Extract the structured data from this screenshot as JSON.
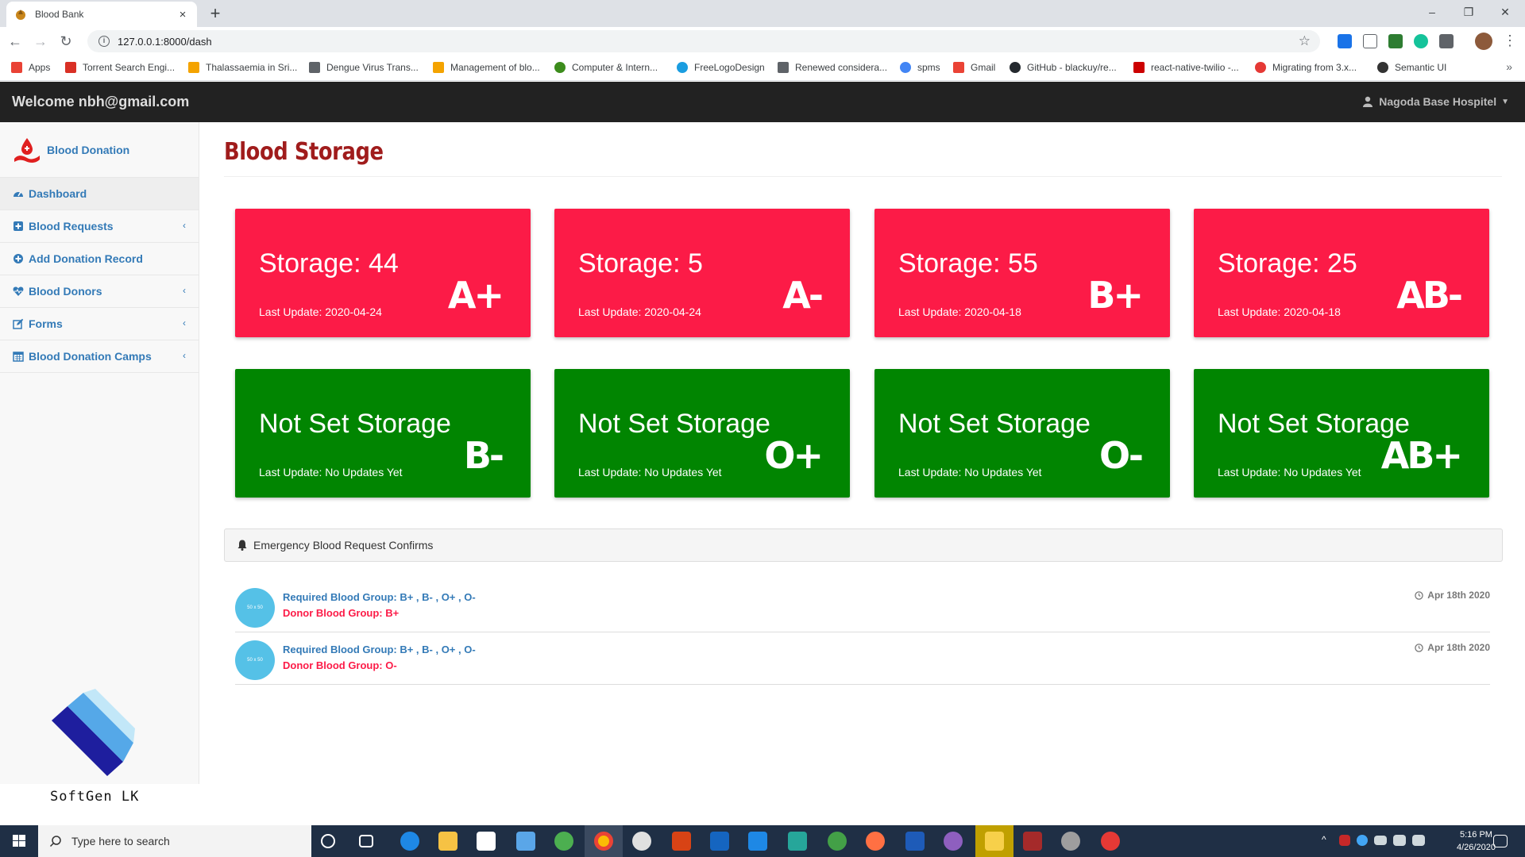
{
  "browser": {
    "tab_title": "Blood Bank",
    "tab_close": "×",
    "new_tab": "+",
    "url": "127.0.0.1:8000/dash",
    "window_minimize": "–",
    "window_restore": "❐",
    "window_close": "✕",
    "bookmarks": [
      {
        "label": "Apps",
        "color": "#e94235"
      },
      {
        "label": "Torrent Search Engi...",
        "color": "#d93025"
      },
      {
        "label": "Thalassaemia in Sri...",
        "color": "#f4a300"
      },
      {
        "label": "Dengue Virus Trans...",
        "color": "#5f6368"
      },
      {
        "label": "Management of blo...",
        "color": "#f4a300"
      },
      {
        "label": "Computer & Intern...",
        "color": "#3c8c1c"
      },
      {
        "label": "FreeLogoDesign",
        "color": "#1a9de0"
      },
      {
        "label": "Renewed considera...",
        "color": "#5f6368"
      },
      {
        "label": "spms",
        "color": "#4285f4"
      },
      {
        "label": "Gmail",
        "color": "#ea4335"
      },
      {
        "label": "GitHub - blackuy/re...",
        "color": "#24292e"
      },
      {
        "label": "react-native-twilio -...",
        "color": "#cc0000"
      },
      {
        "label": "Migrating from 3.x...",
        "color": "#e53935"
      },
      {
        "label": "Semantic UI",
        "color": "#333333"
      }
    ],
    "bookmarks_more": "»"
  },
  "topnav": {
    "welcome": "Welcome nbh@gmail.com",
    "hospital": "Nagoda Base Hospitel"
  },
  "sidebar": {
    "brand": "Blood Donation",
    "items": [
      {
        "label": "Dashboard",
        "icon": "dashboard-icon",
        "has_submenu": false
      },
      {
        "label": "Blood Requests",
        "icon": "plus-square-icon",
        "has_submenu": true
      },
      {
        "label": "Add Donation Record",
        "icon": "plus-circle-icon",
        "has_submenu": false
      },
      {
        "label": "Blood Donors",
        "icon": "heartbeat-icon",
        "has_submenu": true
      },
      {
        "label": "Forms",
        "icon": "edit-icon",
        "has_submenu": true
      },
      {
        "label": "Blood Donation Camps",
        "icon": "calendar-icon",
        "has_submenu": true
      }
    ],
    "company": "SoftGen LK"
  },
  "main": {
    "title": "Blood Storage",
    "cards": [
      {
        "storage": "Storage: 44",
        "updated": "Last Update: 2020-04-24",
        "group": "A+",
        "status": "red"
      },
      {
        "storage": "Storage: 5",
        "updated": "Last Update: 2020-04-24",
        "group": "A-",
        "status": "red"
      },
      {
        "storage": "Storage: 55",
        "updated": "Last Update: 2020-04-18",
        "group": "B+",
        "status": "red"
      },
      {
        "storage": "Storage: 25",
        "updated": "Last Update: 2020-04-18",
        "group": "AB-",
        "status": "red"
      },
      {
        "storage": "Not Set Storage",
        "updated": "Last Update: No Updates Yet",
        "group": "B-",
        "status": "green"
      },
      {
        "storage": "Not Set Storage",
        "updated": "Last Update: No Updates Yet",
        "group": "O+",
        "status": "green"
      },
      {
        "storage": "Not Set Storage",
        "updated": "Last Update: No Updates Yet",
        "group": "O-",
        "status": "green"
      },
      {
        "storage": "Not Set Storage",
        "updated": "Last Update: No Updates Yet",
        "group": "AB+",
        "status": "green"
      }
    ],
    "panel_title": "Emergency Blood Request Confirms",
    "requests": [
      {
        "avatar_text": "50 x 50",
        "required": "Required Blood Group: B+ , B- , O+ , O-",
        "donor": "Donor Blood Group: B+",
        "date": "Apr 18th 2020"
      },
      {
        "avatar_text": "50 x 50",
        "required": "Required Blood Group: B+ , B- , O+ , O-",
        "donor": "Donor Blood Group: O-",
        "date": "Apr 18th 2020"
      }
    ]
  },
  "colors": {
    "low_storage": "#fc1b47",
    "not_set": "#018501",
    "link": "#337ab7",
    "title": "#a01c1c"
  },
  "taskbar": {
    "search_placeholder": "Type here to search",
    "time": "5:16 PM",
    "date": "4/26/2020"
  }
}
